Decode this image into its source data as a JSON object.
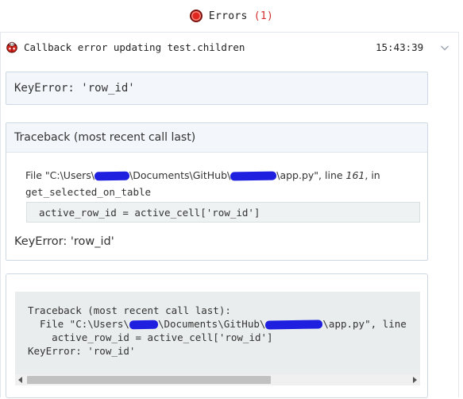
{
  "header": {
    "title": "Errors",
    "count_open": "(",
    "count": "1",
    "count_close": ")"
  },
  "error": {
    "summary": "Callback error updating test.children",
    "timestamp": "15:43:39",
    "message": "KeyError: 'row_id'",
    "traceback_title": "Traceback (most recent call last)",
    "frame": {
      "file_prefix": "File \"C:\\Users\\",
      "file_mid": "\\Documents\\GitHub\\",
      "file_suffix": "\\app.py\", line ",
      "line_number": "161",
      "after_line": ", in",
      "function": "get_selected_on_table",
      "code": "active_row_id = active_cell['row_id']"
    },
    "final_error": "KeyError: 'row_id'"
  },
  "raw_traceback": {
    "line1": "Traceback (most recent call last):",
    "line2_prefix": "  File \"C:\\Users\\",
    "line2_mid": "\\Documents\\GitHub\\",
    "line2_suffix": "\\app.py\", line",
    "line3": "    active_row_id = active_cell['row_id']",
    "line4": "KeyError: 'row_id'",
    "scroll_position": 0,
    "visible_fraction": 0.64
  },
  "colors": {
    "error_dot": "#e0271f",
    "count": "#d32f2f",
    "redaction": "#1f1fe0",
    "box_background": "#f3f6fa",
    "code_background": "#eaeded"
  },
  "icons": {
    "header": "error-dot-icon",
    "summary": "bug-icon",
    "toggle": "chevron-down-icon"
  }
}
